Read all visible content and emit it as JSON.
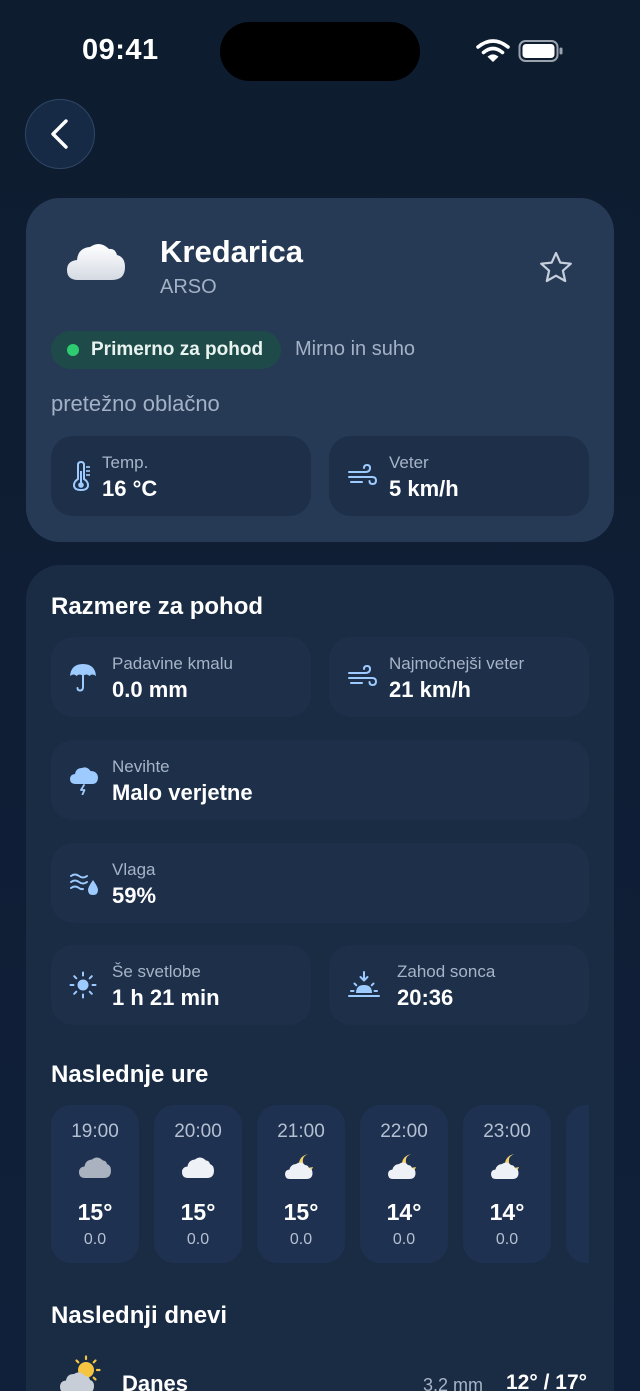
{
  "status_bar": {
    "time": "09:41"
  },
  "header": {
    "station_name": "Kredarica",
    "source": "ARSO",
    "badge_label": "Primerno za pohod",
    "badge_note": "Mirno in suho",
    "description": "pretežno oblačno",
    "tiles": [
      {
        "label": "Temp.",
        "value": "16 °C"
      },
      {
        "label": "Veter",
        "value": "5 km/h"
      }
    ]
  },
  "conditions": {
    "title": "Razmere za pohod",
    "precip": {
      "label": "Padavine kmalu",
      "value": "0.0 mm"
    },
    "gust": {
      "label": "Najmočnejši veter",
      "value": "21 km/h"
    },
    "storms": {
      "label": "Nevihte",
      "value": "Malo verjetne"
    },
    "humidity": {
      "label": "Vlaga",
      "value": "59%"
    },
    "daylight": {
      "label": "Še svetlobe",
      "value": "1 h 21 min"
    },
    "sunset": {
      "label": "Zahod sonca",
      "value": "20:36"
    }
  },
  "hourly": {
    "title": "Naslednje ure",
    "items": [
      {
        "time": "19:00",
        "icon": "cloud-icon",
        "temp": "15°",
        "rain": "0.0"
      },
      {
        "time": "20:00",
        "icon": "cloud-icon",
        "temp": "15°",
        "rain": "0.0"
      },
      {
        "time": "21:00",
        "icon": "moon-cloud-icon",
        "temp": "15°",
        "rain": "0.0"
      },
      {
        "time": "22:00",
        "icon": "moon-cloud-icon",
        "temp": "14°",
        "rain": "0.0"
      },
      {
        "time": "23:00",
        "icon": "moon-cloud-icon",
        "temp": "14°",
        "rain": "0.0"
      }
    ]
  },
  "daily": {
    "title": "Naslednji dnevi",
    "items": [
      {
        "name": "Danes",
        "rain": "3.2 mm",
        "temps": "12° / 17°",
        "icon": "sun-cloud-icon"
      }
    ]
  },
  "colors": {
    "background": "#0f1d30",
    "card": "#263a56",
    "accent_green": "#2ecc71",
    "muted_text": "#a3b1c5"
  }
}
